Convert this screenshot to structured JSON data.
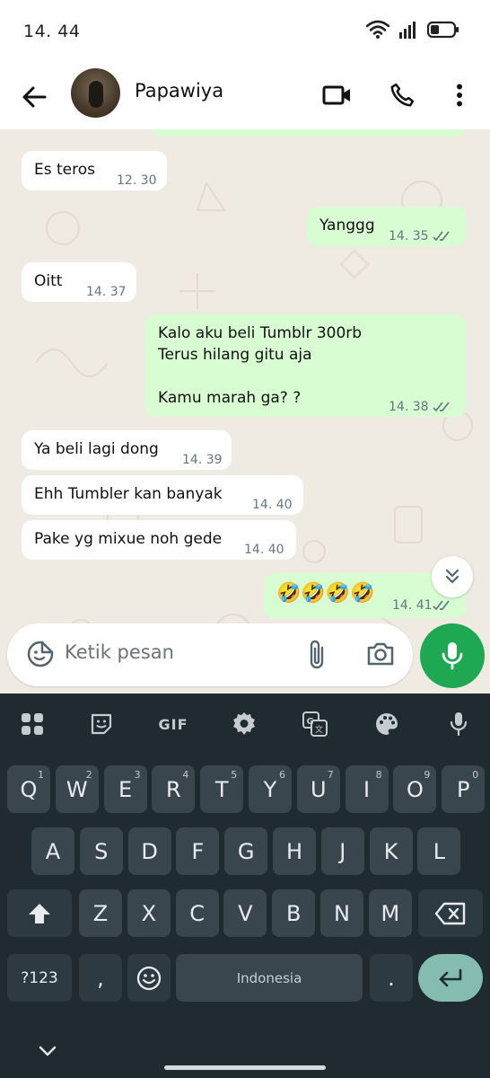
{
  "status_bar": {
    "time": "14. 44"
  },
  "header": {
    "contact_name": "Papawiya"
  },
  "messages": [
    {
      "dir": "in",
      "text": "Es teros",
      "time": "12. 30"
    },
    {
      "dir": "out",
      "text": "Yanggg",
      "time": "14. 35",
      "status": "read"
    },
    {
      "dir": "in",
      "text": "Oitt",
      "time": "14. 37"
    },
    {
      "dir": "out",
      "text": "Kalo aku beli Tumblr 300rb\nTerus hilang gitu aja\n\nKamu marah ga? ?",
      "time": "14. 38",
      "status": "read"
    },
    {
      "dir": "in",
      "text": "Ya beli lagi dong",
      "time": "14. 39"
    },
    {
      "dir": "in",
      "text": "Ehh Tumbler kan banyak",
      "time": "14. 40"
    },
    {
      "dir": "in",
      "text": "Pake yg mixue noh gede",
      "time": "14. 40"
    },
    {
      "dir": "out",
      "text": "🤣🤣🤣🤣",
      "time": "14. 41",
      "status": "read"
    }
  ],
  "composer": {
    "placeholder": "Ketik pesan"
  },
  "keyboard": {
    "toolbar": [
      "apps-icon",
      "sticker-icon",
      "GIF",
      "settings-icon",
      "translate-icon",
      "palette-icon",
      "mic-icon"
    ],
    "row1": [
      {
        "k": "Q",
        "h": "1"
      },
      {
        "k": "W",
        "h": "2"
      },
      {
        "k": "E",
        "h": "3"
      },
      {
        "k": "R",
        "h": "4"
      },
      {
        "k": "T",
        "h": "5"
      },
      {
        "k": "Y",
        "h": "6"
      },
      {
        "k": "U",
        "h": "7"
      },
      {
        "k": "I",
        "h": "8"
      },
      {
        "k": "O",
        "h": "9"
      },
      {
        "k": "P",
        "h": "0"
      }
    ],
    "row2": [
      "A",
      "S",
      "D",
      "F",
      "G",
      "H",
      "J",
      "K",
      "L"
    ],
    "row3": [
      "Z",
      "X",
      "C",
      "V",
      "B",
      "N",
      "M"
    ],
    "symbols_label": "?123",
    "comma": ",",
    "space_label": "Indonesia",
    "period": "."
  },
  "colors": {
    "chat_bg": "#efeae2",
    "incoming_bubble": "#ffffff",
    "outgoing_bubble": "#d9fdd3",
    "mic_button": "#1da851",
    "keyboard_bg": "#1f2a31",
    "key_bg": "#3a464d",
    "enter_key": "#84bcb0"
  }
}
